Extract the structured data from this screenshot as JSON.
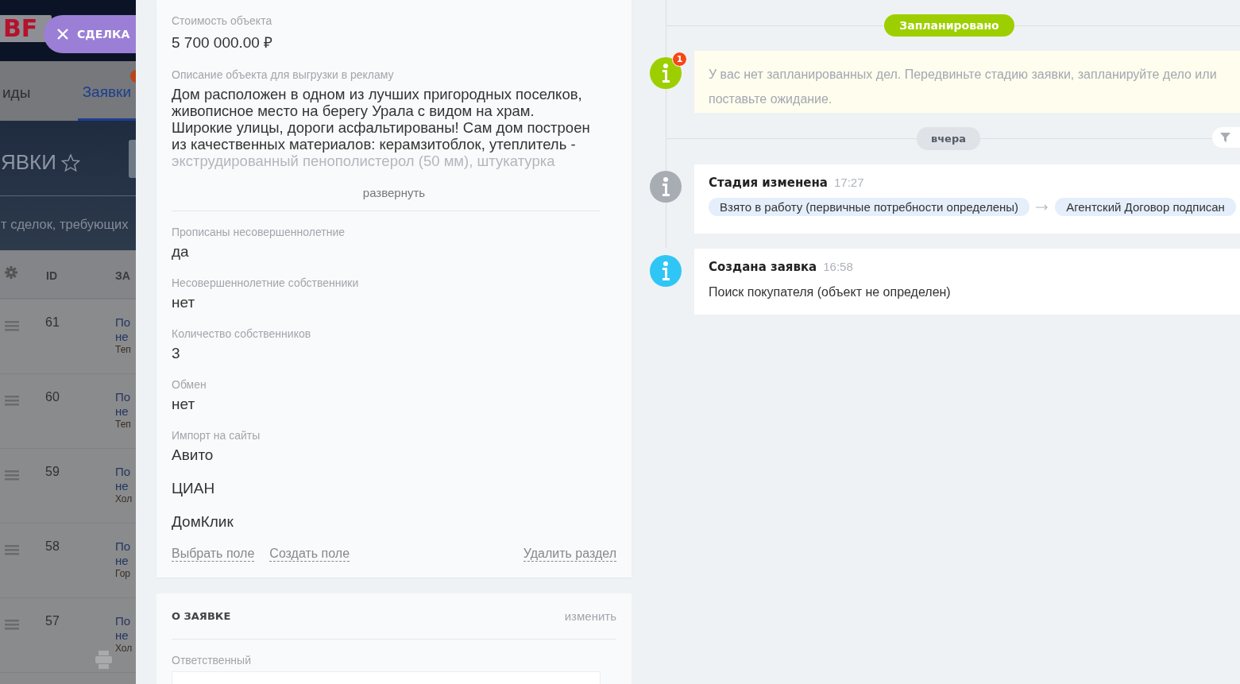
{
  "background_page": {
    "logo": "BF",
    "deal_chip": {
      "label": "СДЕЛКА"
    },
    "tabs": [
      {
        "label": "иды",
        "selected": false,
        "badge": false
      },
      {
        "label": "Заявки",
        "selected": true,
        "badge": true
      }
    ],
    "title": "ЯВКИ",
    "subtitle": "т сделок, требующих",
    "table": {
      "columns": [
        "ID",
        "ЗА"
      ],
      "rows": [
        {
          "id": "61",
          "line_1": "По",
          "line_2": "не",
          "line_3": "Теп"
        },
        {
          "id": "60",
          "line_1": "По",
          "line_2": "не",
          "line_3": "Теп"
        },
        {
          "id": "59",
          "line_1": "По",
          "line_2": "не",
          "line_3": "Хол"
        },
        {
          "id": "58",
          "line_1": "По",
          "line_2": "не",
          "line_3": "Гор"
        },
        {
          "id": "57",
          "line_1": "По",
          "line_2": "не",
          "line_3": "Хол"
        }
      ]
    }
  },
  "details_card": {
    "price": {
      "label": "Стоимость объекта",
      "value": "5 700 000.00 ₽"
    },
    "description": {
      "label": "Описание объекта для выгрузки в рекламу",
      "text": "Дом расположен в одном из лучших пригородных поселков, живописное место на берегу Урала с видом на храм. Широкие улицы, дороги асфальтированы! Сам дом построен из качественных материалов: керамзитоблок, утеплитель -",
      "faded_text": "экструдированный пенополистерол (50 мм), штукатурка",
      "expand": "развернуть"
    },
    "fields": [
      {
        "label": "Прописаны несовершеннолетние",
        "values": [
          "да"
        ]
      },
      {
        "label": "Несовершеннолетние собственники",
        "values": [
          "нет"
        ]
      },
      {
        "label": "Количество собственников",
        "values": [
          "3"
        ]
      },
      {
        "label": "Обмен",
        "values": [
          "нет"
        ]
      },
      {
        "label": "Импорт на сайты",
        "values": [
          "Авито",
          "ЦИАН",
          "ДомКлик"
        ]
      }
    ],
    "actions": [
      "Выбрать поле",
      "Создать поле"
    ],
    "delete_action": "Удалить раздел"
  },
  "about_card": {
    "title": "О ЗАЯВКЕ",
    "edit": "изменить",
    "field_label": "Ответственный"
  },
  "timeline": {
    "status": "Запланировано",
    "notice": {
      "badge": "1",
      "text": "У вас нет запланированных дел. Передвиньте стадию заявки, запланируйте дело или поставьте ожидание."
    },
    "date": "вчера",
    "events": [
      {
        "kind": "stage",
        "color": "#a8adb4",
        "title": "Стадия изменена",
        "time": "17:27",
        "from": "Взято в работу (первичные потребности определены)",
        "to": "Агентский Договор подписан"
      },
      {
        "kind": "created",
        "color": "#2fc6f6",
        "title": "Создана заявка",
        "time": "16:58",
        "text": "Поиск покупателя (объект не определен)"
      }
    ]
  }
}
